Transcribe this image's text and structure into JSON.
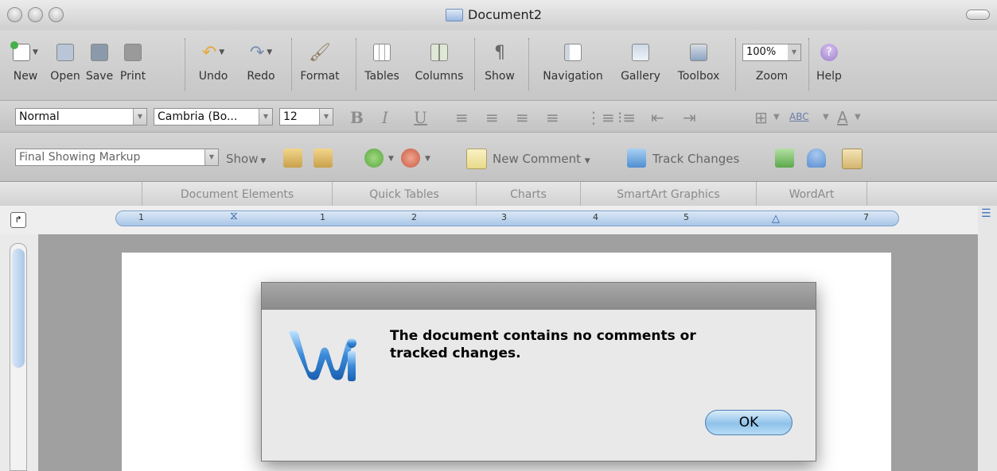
{
  "window": {
    "title": "Document2"
  },
  "standard_toolbar": [
    {
      "label": "New",
      "icon": "new-document-icon"
    },
    {
      "label": "Open",
      "icon": "open-folder-icon"
    },
    {
      "label": "Save",
      "icon": "save-disk-icon"
    },
    {
      "label": "Print",
      "icon": "printer-icon"
    },
    {
      "label": "Undo",
      "icon": "undo-icon"
    },
    {
      "label": "Redo",
      "icon": "redo-icon"
    },
    {
      "label": "Format",
      "icon": "format-brush-icon"
    },
    {
      "label": "Tables",
      "icon": "tables-grid-icon"
    },
    {
      "label": "Columns",
      "icon": "columns-icon"
    },
    {
      "label": "Show",
      "icon": "pilcrow-icon"
    },
    {
      "label": "Navigation",
      "icon": "navigation-pane-icon"
    },
    {
      "label": "Gallery",
      "icon": "gallery-icon"
    },
    {
      "label": "Toolbox",
      "icon": "toolbox-icon"
    },
    {
      "label": "Zoom",
      "icon": "zoom-combo"
    },
    {
      "label": "Help",
      "icon": "help-icon"
    }
  ],
  "zoom": {
    "value": "100%"
  },
  "formatting": {
    "style": "Normal",
    "font": "Cambria (Bo...",
    "size": "12"
  },
  "reviewing": {
    "markup_view": "Final Showing Markup",
    "show_label": "Show",
    "new_comment": "New Comment",
    "track_changes": "Track Changes"
  },
  "elements_gallery": {
    "tabs": [
      "Document Elements",
      "Quick Tables",
      "Charts",
      "SmartArt Graphics",
      "WordArt"
    ]
  },
  "ruler": {
    "numbers": [
      "1",
      "1",
      "2",
      "3",
      "4",
      "5",
      "7"
    ]
  },
  "dialog": {
    "message_line1": "The document contains no comments or",
    "message_line2": "tracked changes.",
    "ok_label": "OK"
  }
}
